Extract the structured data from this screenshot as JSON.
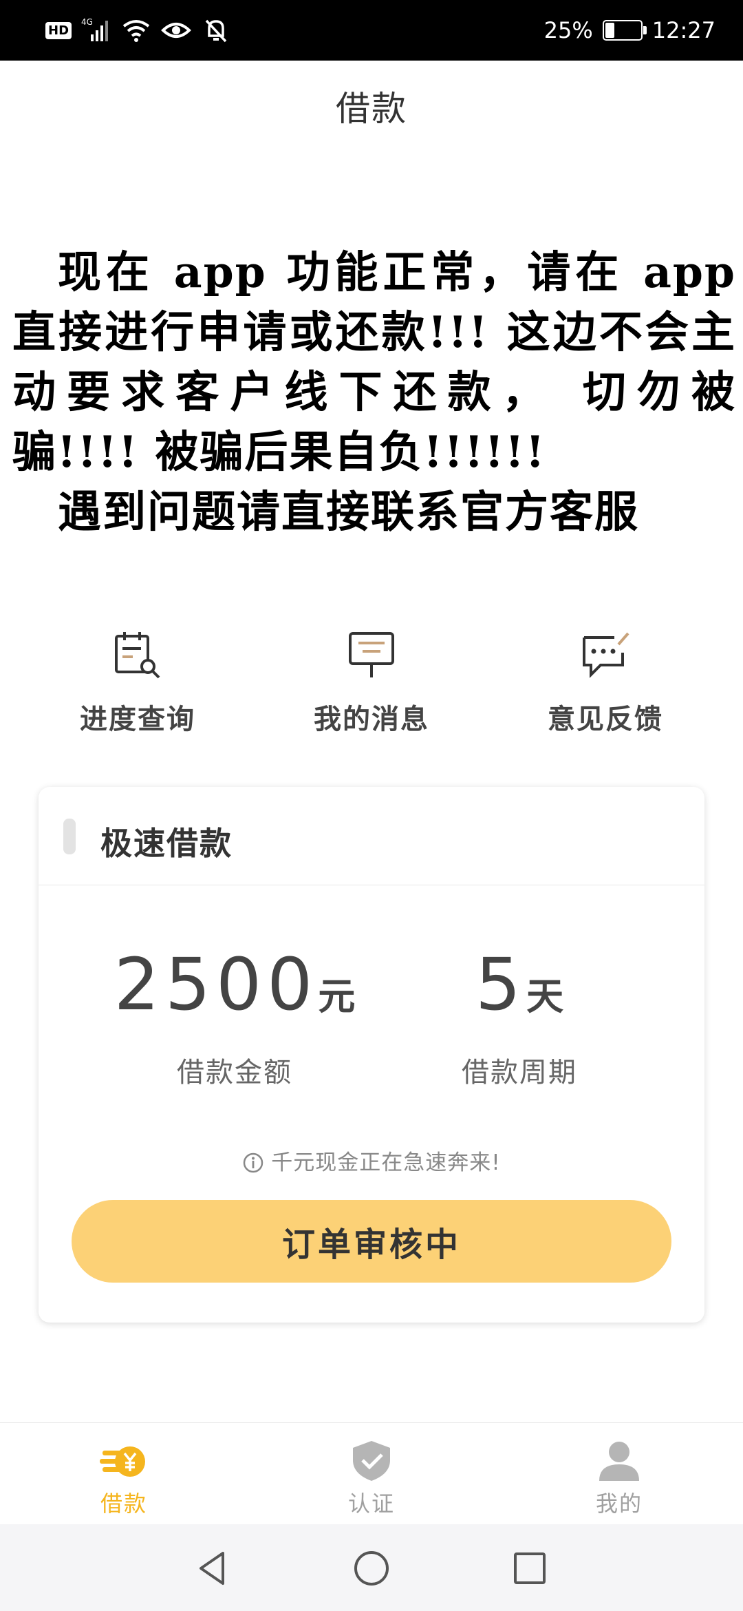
{
  "status_bar": {
    "hd": "HD",
    "network": "4G",
    "battery_percent": "25%",
    "battery_level": 0.25,
    "time": "12:27",
    "icons": [
      "signal-icon",
      "wifi-icon",
      "eye-icon",
      "bell-off-icon",
      "battery-icon"
    ]
  },
  "header": {
    "title": "借款"
  },
  "notice": {
    "paragraph1": "现在 app 功能正常，请在 app 直接进行申请或还款!!! 这边不会主动要求客户线下还款， 切勿被骗!!!! 被骗后果自负!!!!!!",
    "paragraph2": "遇到问题请直接联系官方客服"
  },
  "shortcuts": [
    {
      "label": "进度查询",
      "icon": "progress-search-icon"
    },
    {
      "label": "我的消息",
      "icon": "message-icon"
    },
    {
      "label": "意见反馈",
      "icon": "feedback-icon"
    }
  ],
  "loan_card": {
    "title": "极速借款",
    "amount_value": "2500",
    "amount_unit": "元",
    "amount_label": "借款金额",
    "period_value": "5",
    "period_unit": "天",
    "period_label": "借款周期",
    "tip": "千元现金正在急速奔来!",
    "button_label": "订单审核中"
  },
  "bottom_nav": [
    {
      "label": "借款",
      "icon": "loan-coin-icon",
      "active": true
    },
    {
      "label": "认证",
      "icon": "shield-check-icon",
      "active": false
    },
    {
      "label": "我的",
      "icon": "user-icon",
      "active": false
    }
  ],
  "colors": {
    "accent": "#f5b51e",
    "button": "#fcd176",
    "inactive": "#b5b5b5"
  }
}
